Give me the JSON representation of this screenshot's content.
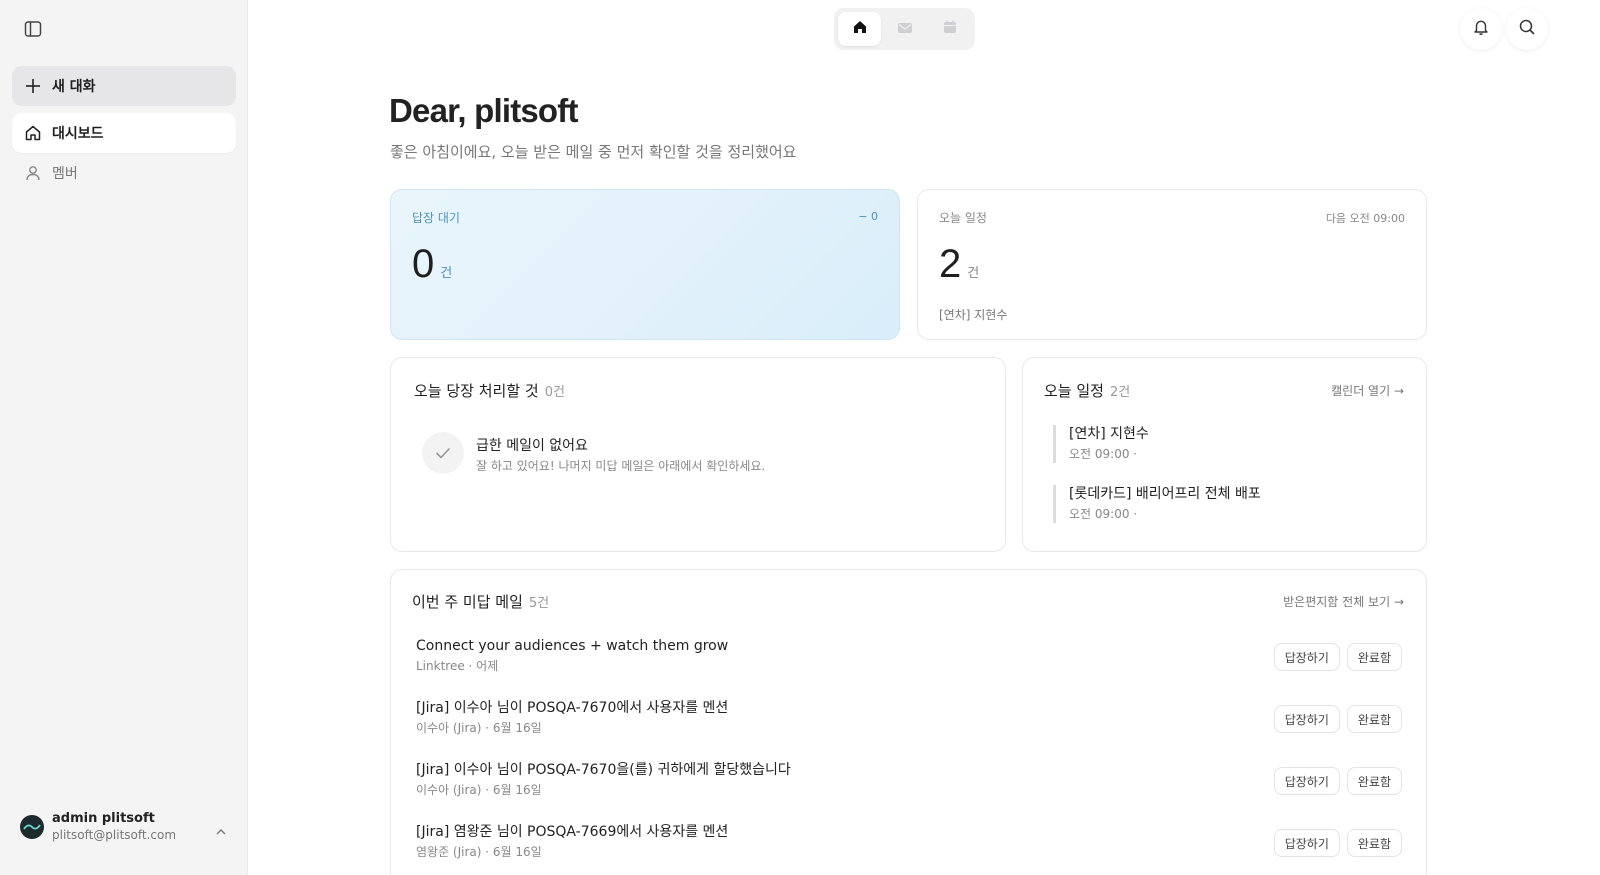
{
  "sidebar": {
    "new_chat": "새 대화",
    "items": [
      {
        "label": "대시보드",
        "active": true
      },
      {
        "label": "멤버",
        "active": false
      }
    ],
    "profile": {
      "name": "admin plitsoft",
      "email": "plitsoft@plitsoft.com"
    }
  },
  "topbar": {
    "tabs": [
      "home-icon",
      "mail-icon",
      "calendar-icon"
    ],
    "active_tab": 0
  },
  "header": {
    "greeting": "Dear, plitsoft",
    "subtitle": "좋은 아침이에요, 오늘 받은 메일 중 먼저 확인할 것을 정리했어요"
  },
  "stats": {
    "reply_pending": {
      "label": "답장 대기",
      "delta": "− 0",
      "value": "0",
      "unit": "건"
    },
    "schedule": {
      "label": "오늘 일정",
      "next": "다음 오전 09:00",
      "value": "2",
      "unit": "건",
      "first": "[연차] 지현수"
    }
  },
  "urgent": {
    "title": "오늘 당장 처리할 것",
    "count": "0건",
    "empty_title": "급한 메일이 없어요",
    "empty_sub": "잘 하고 있어요! 나머지 미답 메일은 아래에서 확인하세요."
  },
  "today_schedule": {
    "title": "오늘 일정",
    "count": "2건",
    "link": "캘린더 열기 →",
    "events": [
      {
        "title": "[연차] 지현수",
        "time": "오전 09:00 ·"
      },
      {
        "title": "[롯데카드] 배리어프리 전체 배포",
        "time": "오전 09:00 ·"
      }
    ]
  },
  "unanswered": {
    "title": "이번 주 미답 메일",
    "count": "5건",
    "link": "받은편지함 전체 보기 →",
    "reply_label": "답장하기",
    "done_label": "완료함",
    "mails": [
      {
        "subject": "Connect your audiences + watch them grow",
        "meta": "Linktree · 어제"
      },
      {
        "subject": "[Jira] 이수아 님이 POSQA-7670에서 사용자를 멘션",
        "meta": "이수아 (Jira) · 6월 16일"
      },
      {
        "subject": "[Jira] 이수아 님이 POSQA-7670을(를) 귀하에게 할당했습니다",
        "meta": "이수아 (Jira) · 6월 16일"
      },
      {
        "subject": "[Jira] 염왕준 님이 POSQA-7669에서 사용자를 멘션",
        "meta": "염왕준 (Jira) · 6월 16일"
      }
    ]
  },
  "colors": {
    "accent_blue": "#4d93b8",
    "card_blue_bg": "#e2f1fb"
  }
}
